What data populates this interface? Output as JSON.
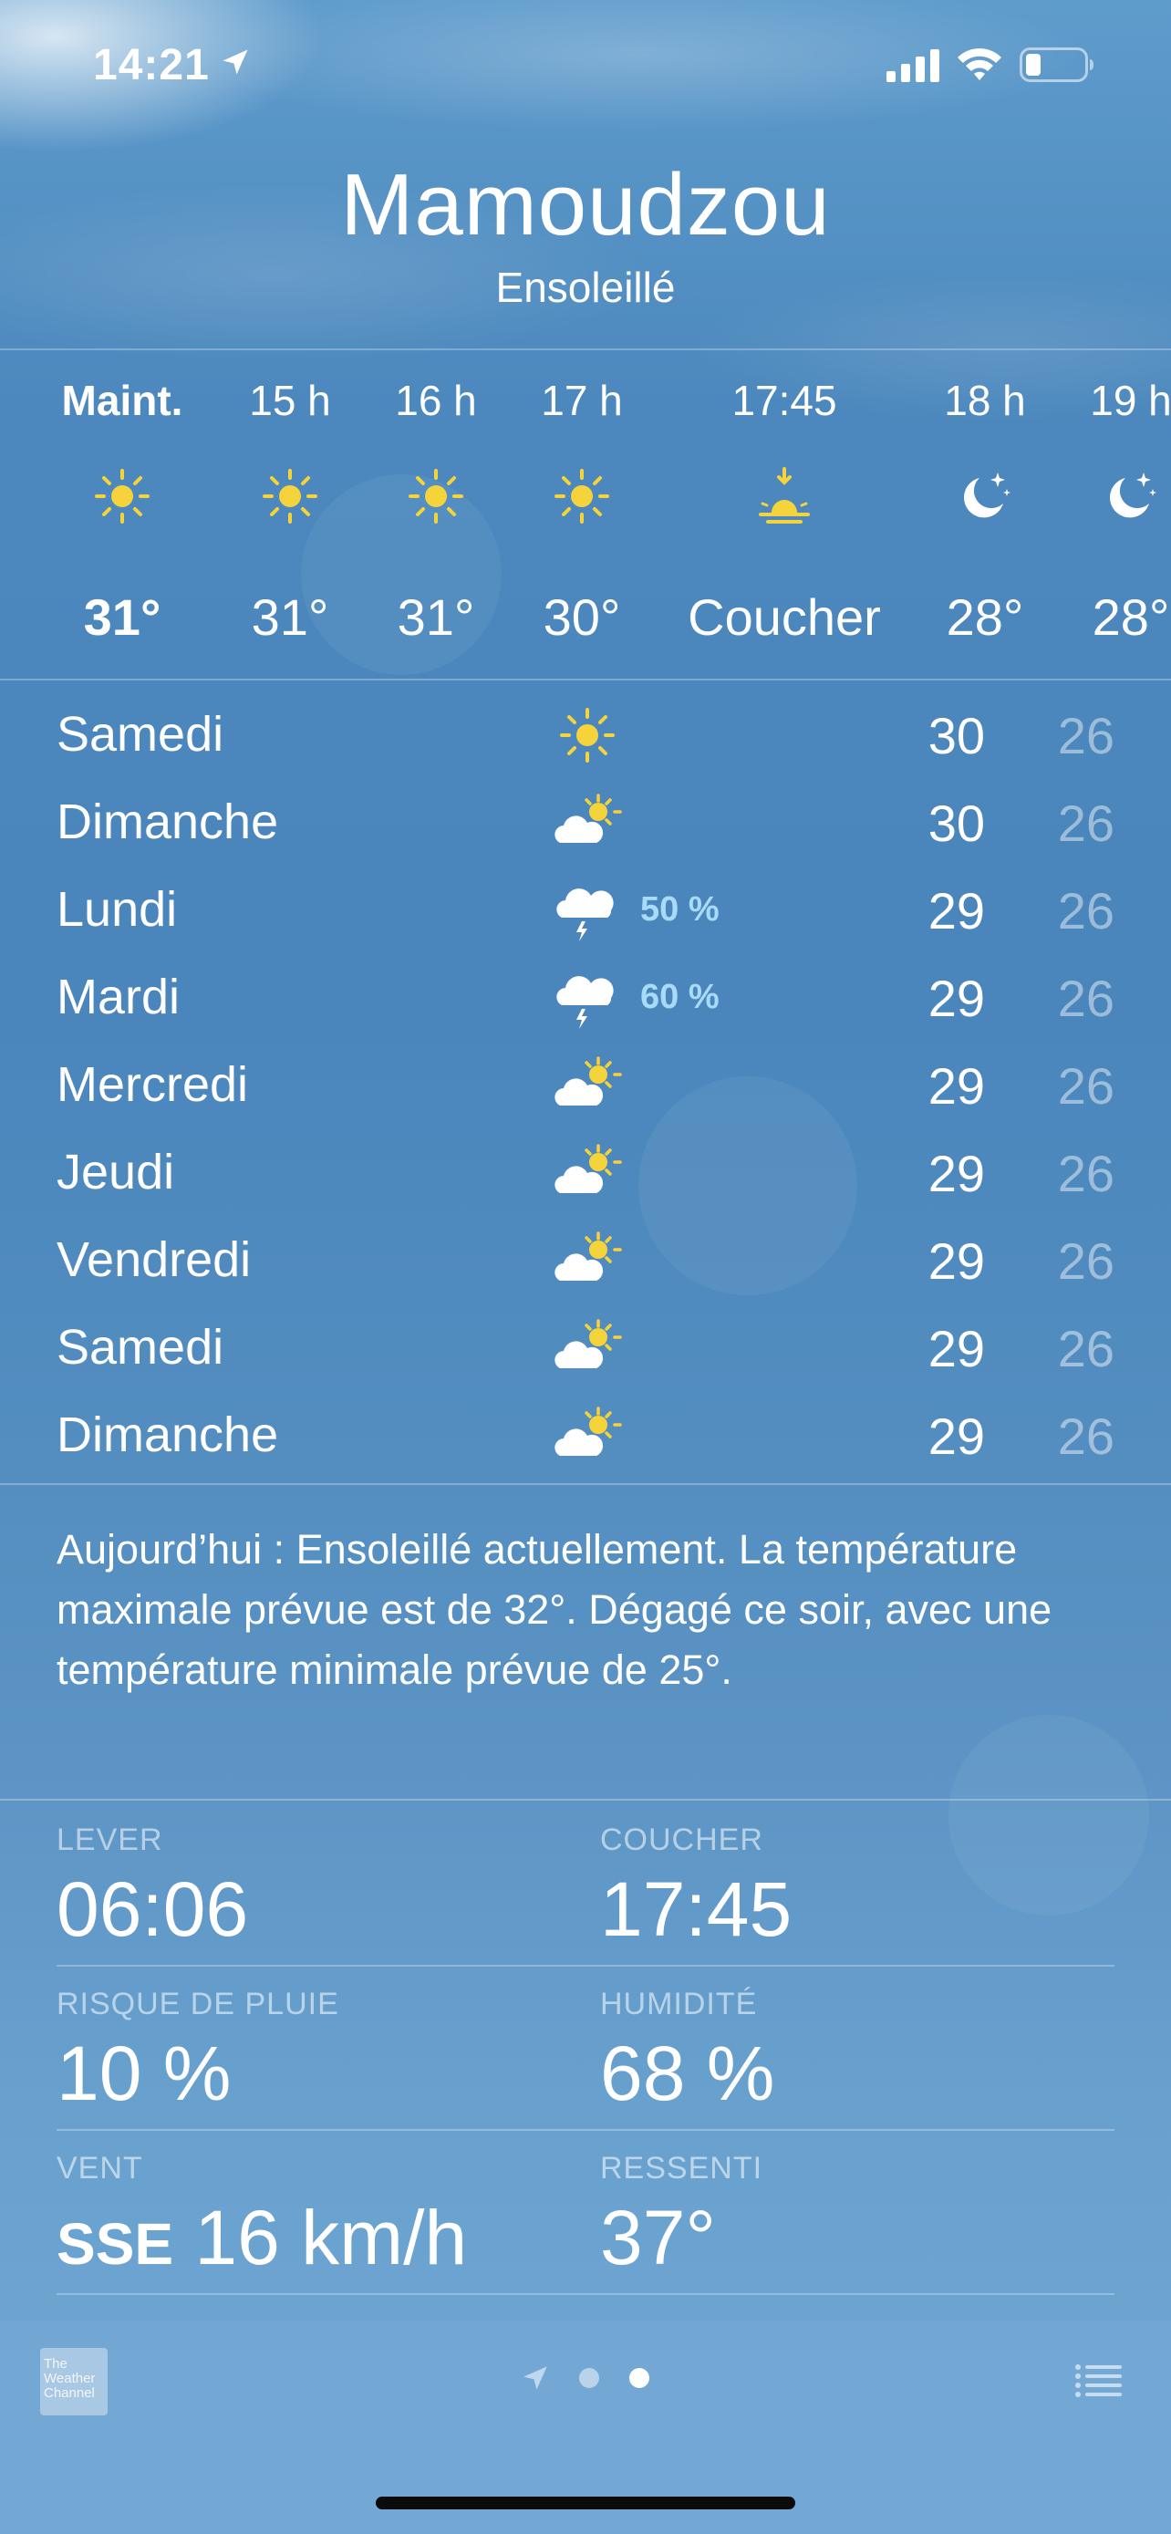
{
  "status_bar": {
    "time": "14:21"
  },
  "header": {
    "city": "Mamoudzou",
    "condition": "Ensoleillé"
  },
  "hourly": [
    {
      "label": "Maint.",
      "icon": "sun-icon",
      "temp": "31°",
      "bold": true
    },
    {
      "label": "15 h",
      "icon": "sun-icon",
      "temp": "31°"
    },
    {
      "label": "16 h",
      "icon": "sun-icon",
      "temp": "31°"
    },
    {
      "label": "17 h",
      "icon": "sun-icon",
      "temp": "30°"
    },
    {
      "label": "17:45",
      "icon": "sunset-icon",
      "temp": "Coucher"
    },
    {
      "label": "18 h",
      "icon": "moon-stars-icon",
      "temp": "28°"
    },
    {
      "label": "19 h",
      "icon": "moon-stars-icon",
      "temp": "28°"
    }
  ],
  "daily": [
    {
      "day": "Samedi",
      "icon": "sun-icon",
      "precip": "",
      "high": "30",
      "low": "26"
    },
    {
      "day": "Dimanche",
      "icon": "partly-cloudy-icon",
      "precip": "",
      "high": "30",
      "low": "26"
    },
    {
      "day": "Lundi",
      "icon": "thunderstorm-icon",
      "precip": "50 %",
      "high": "29",
      "low": "26"
    },
    {
      "day": "Mardi",
      "icon": "thunderstorm-icon",
      "precip": "60 %",
      "high": "29",
      "low": "26"
    },
    {
      "day": "Mercredi",
      "icon": "partly-cloudy-icon",
      "precip": "",
      "high": "29",
      "low": "26"
    },
    {
      "day": "Jeudi",
      "icon": "partly-cloudy-icon",
      "precip": "",
      "high": "29",
      "low": "26"
    },
    {
      "day": "Vendredi",
      "icon": "partly-cloudy-icon",
      "precip": "",
      "high": "29",
      "low": "26"
    },
    {
      "day": "Samedi",
      "icon": "partly-cloudy-icon",
      "precip": "",
      "high": "29",
      "low": "26"
    },
    {
      "day": "Dimanche",
      "icon": "partly-cloudy-icon",
      "precip": "",
      "high": "29",
      "low": "26"
    }
  ],
  "summary": "Aujourd’hui : Ensoleillé actuellement. La température maximale prévue est de 32°. Dégagé ce soir, avec une température minimale prévue de 25°.",
  "details": {
    "sunrise": {
      "label": "LEVER",
      "value": "06:06"
    },
    "sunset": {
      "label": "COUCHER",
      "value": "17:45"
    },
    "rain": {
      "label": "RISQUE DE PLUIE",
      "value": "10 %"
    },
    "humidity": {
      "label": "HUMIDITÉ",
      "value": "68 %"
    },
    "wind": {
      "label": "VENT",
      "direction": "SSE",
      "value": "16 km/h"
    },
    "feels_like": {
      "label": "RESSENTI",
      "value": "37°"
    }
  },
  "toolbar": {
    "logo_text": "The Weather Channel",
    "page_count": 2,
    "current_page": 2
  },
  "colors": {
    "sun": "#f5d33b",
    "precip": "#a7dbf7",
    "background": "#4c88bd"
  }
}
